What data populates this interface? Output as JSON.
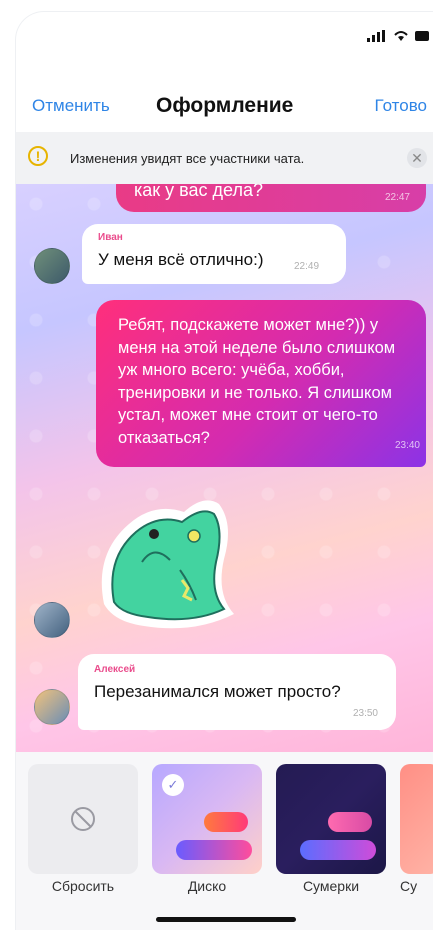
{
  "nav": {
    "cancel": "Отменить",
    "title": "Оформление",
    "done": "Готово"
  },
  "banner": {
    "text": "Изменения увидят все участники чата.",
    "icon": "warning-icon"
  },
  "messages": {
    "top": {
      "text": "как у вас дела?",
      "time": "22:47"
    },
    "ivan": {
      "author": "Иван",
      "text": "У меня всё отлично:)",
      "time": "22:49"
    },
    "long": {
      "text": "Ребят, подскажете может мне?)) у меня на этой неделе было слишком уж много всего: учёба, хобби, тренировки и не только. Я слишком устал, может мне стоит от чего-то отказаться?",
      "time": "23:40"
    },
    "alexey": {
      "author": "Алексей",
      "text": "Перезанимался может просто?",
      "time": "23:50"
    }
  },
  "themes": [
    {
      "label": "Сбросить"
    },
    {
      "label": "Диско",
      "selected": true
    },
    {
      "label": "Сумерки"
    },
    {
      "label": "Су"
    }
  ],
  "colors": {
    "accent": "#2f85e6",
    "name": "#ea4c8c",
    "bubble_from": "#ff2f7b",
    "bubble_to": "#8c33e6"
  }
}
